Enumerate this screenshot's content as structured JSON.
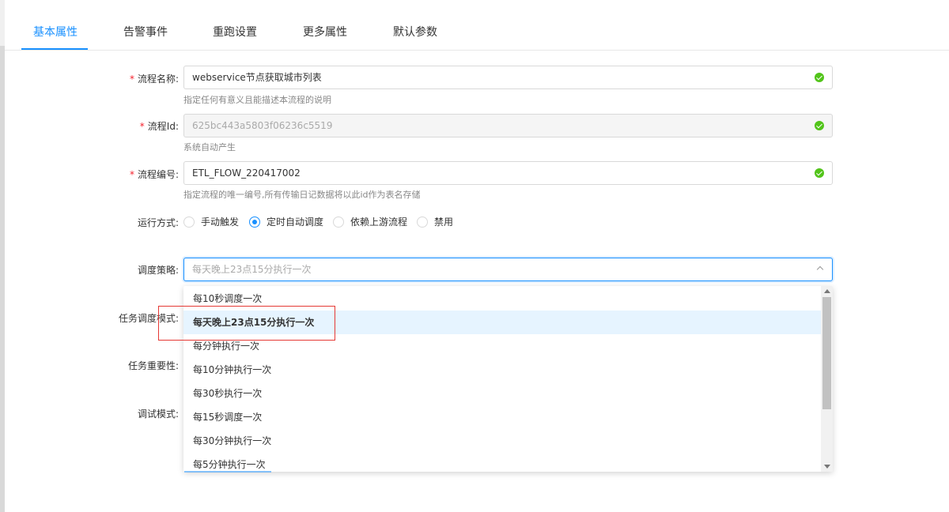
{
  "tabs": [
    {
      "label": "基本属性",
      "active": true
    },
    {
      "label": "告警事件"
    },
    {
      "label": "重跑设置"
    },
    {
      "label": "更多属性"
    },
    {
      "label": "默认参数"
    }
  ],
  "form": {
    "name": {
      "label": "流程名称:",
      "required": true,
      "value": "webservice节点获取城市列表",
      "help": "指定任何有意义且能描述本流程的说明"
    },
    "id": {
      "label": "流程Id:",
      "required": true,
      "value": "625bc443a5803f06236c5519",
      "help": "系统自动产生"
    },
    "code": {
      "label": "流程编号:",
      "required": true,
      "value": "ETL_FLOW_220417002",
      "help": "指定流程的唯一编号,所有传输日记数据将以此id作为表名存储"
    },
    "run_mode": {
      "label": "运行方式:",
      "options": [
        "手动触发",
        "定时自动调度",
        "依赖上游流程",
        "禁用"
      ],
      "selected": "定时自动调度"
    },
    "strategy": {
      "label": "调度策略:",
      "value": "每天晚上23点15分执行一次",
      "options": [
        "每10秒调度一次",
        "每天晚上23点15分执行一次",
        "每分钟执行一次",
        "每10分钟执行一次",
        "每30秒执行一次",
        "每15秒调度一次",
        "每30分钟执行一次",
        "每5分钟执行一次"
      ],
      "highlighted": "每天晚上23点15分执行一次"
    },
    "task_mode_label": "任务调度模式:",
    "importance_label": "任务重要性:",
    "debug_label": "调试模式:"
  },
  "colors": {
    "accent": "#1890ff",
    "required": "#f5222d",
    "success": "#52c41a",
    "highlight_box": "#e53935"
  },
  "icons": {
    "valid": "check-circle-icon",
    "select_arrow": "chevron-up-icon"
  }
}
